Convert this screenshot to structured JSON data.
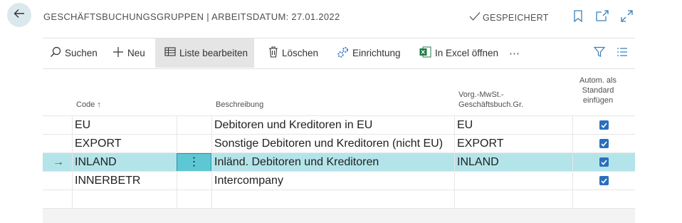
{
  "header": {
    "title": "GESCHÄFTSBUCHUNGSGRUPPEN | ARBEITSDATUM: 27.01.2022",
    "saved_label": "GESPEICHERT",
    "icons": [
      "bookmark-icon",
      "open-in-new-window-icon",
      "expand-icon"
    ]
  },
  "toolbar": {
    "search": "Suchen",
    "new": "Neu",
    "edit_list": "Liste bearbeiten",
    "delete": "Löschen",
    "setup": "Einrichtung",
    "excel": "In Excel öffnen",
    "more": "⋯"
  },
  "columns": {
    "code": "Code ↑",
    "description": "Beschreibung",
    "vat": "Vorg.-MwSt.-\nGeschäftsbuch.Gr.",
    "auto": "Autom. als\nStandard\neinfügen"
  },
  "rows": [
    {
      "code": "EU",
      "description": "Debitoren und Kreditoren in EU",
      "vat": "EU",
      "auto": true
    },
    {
      "code": "EXPORT",
      "description": "Sonstige Debitoren und Kreditoren (nicht EU)",
      "vat": "EXPORT",
      "auto": true
    },
    {
      "code": "INLAND",
      "description": "Inländ. Debitoren und Kreditoren",
      "vat": "INLAND",
      "auto": true,
      "selected": true
    },
    {
      "code": "INNERBETR",
      "description": "Intercompany",
      "vat": "",
      "auto": true
    }
  ],
  "row_menu_glyph": "⋮",
  "selected_arrow": "→",
  "colors": {
    "accent": "#2a6fbd",
    "selected_row": "#b3e4ea",
    "row_menu": "#5dc8d4"
  }
}
